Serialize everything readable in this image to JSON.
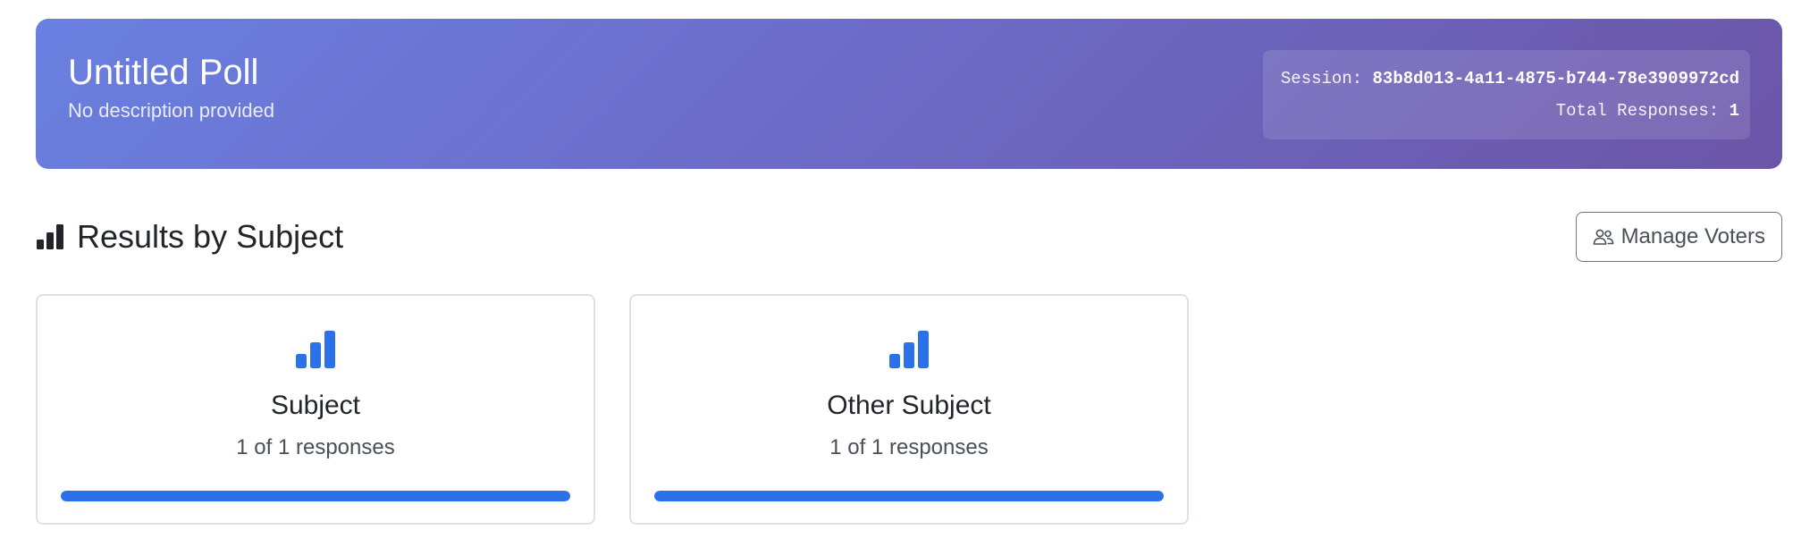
{
  "header": {
    "title": "Untitled Poll",
    "description": "No description provided",
    "session_label": "Session:",
    "session_id": "83b8d013-4a11-4875-b744-78e3909972cd",
    "total_label": "Total Responses:",
    "total_value": "1"
  },
  "section": {
    "title": "Results by Subject",
    "title_icon": "bar-chart-icon",
    "manage_button_label": "Manage Voters",
    "manage_button_icon": "people-icon"
  },
  "subjects": [
    {
      "name": "Subject",
      "responses_text": "1 of 1 responses",
      "progress": 1.0,
      "icon": "bar-chart-icon"
    },
    {
      "name": "Other Subject",
      "responses_text": "1 of 1 responses",
      "progress": 1.0,
      "icon": "bar-chart-icon"
    }
  ],
  "colors": {
    "accent": "#2b72ea",
    "banner_start": "#6a80e0",
    "banner_end": "#6b55a8"
  }
}
